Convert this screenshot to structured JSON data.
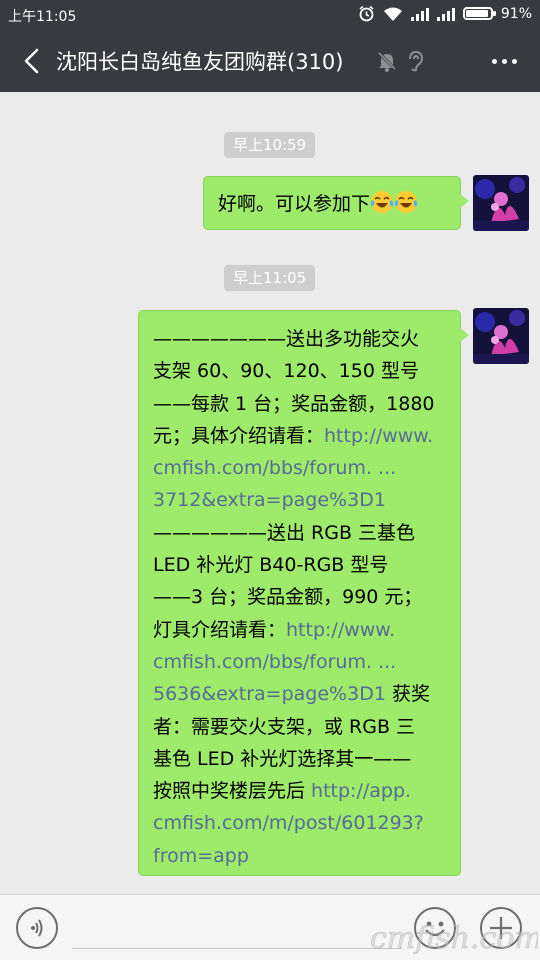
{
  "status_bar": {
    "time": "上午11:05",
    "battery": "91%",
    "icons": [
      "alarm-icon",
      "wifi-icon",
      "signal-icon",
      "signal-icon",
      "battery-icon"
    ]
  },
  "header": {
    "back_icon": "back-arrow-icon",
    "title": "沈阳长白岛纯鱼友团购群(310)",
    "mute_icon": "mute-bell-icon",
    "earpiece_icon": "earpiece-icon",
    "more_icon": "more-icon"
  },
  "messages": [
    {
      "timestamp": "早上10:59",
      "sender": "self",
      "text": "好啊。可以参加下",
      "emojis": [
        "laughing-crying-emoji",
        "laughing-crying-emoji"
      ]
    },
    {
      "timestamp": "早上11:05",
      "sender": "self",
      "lines": [
        {
          "text": "———————送出多功能交火"
        },
        {
          "text": "支架 60、90、120、150 型号"
        },
        {
          "text": "——每款 1 台；奖品金额，1880"
        },
        {
          "text": "元；具体介绍请看：",
          "link": "http://www."
        },
        {
          "link": "cmfish.com/bbs/forum. ..."
        },
        {
          "link": "3712&extra=page%3D1"
        },
        {
          "text": "——————送出 RGB 三基色"
        },
        {
          "text": "LED 补光灯 B40-RGB 型号"
        },
        {
          "text": "——3 台；奖品金额，990 元；"
        },
        {
          "text": "灯具介绍请看：",
          "link": "http://www."
        },
        {
          "link": "cmfish.com/bbs/forum. ..."
        },
        {
          "link": "5636&extra=page%3D1",
          "text_after": " 获奖"
        },
        {
          "text": "者：需要交火支架，或 RGB 三"
        },
        {
          "text": "基色 LED 补光灯选择其一——"
        },
        {
          "text": "按照中奖楼层先后 ",
          "link": "http://app."
        },
        {
          "link": "cmfish.com/m/post/601293?"
        },
        {
          "link": "from=app"
        }
      ]
    }
  ],
  "input_bar": {
    "voice_icon": "voice-icon",
    "input_value": "",
    "emoji_icon": "emoji-icon",
    "plus_icon": "plus-icon"
  },
  "watermark": "cmfish.com",
  "colors": {
    "header_bg": "#393a3f",
    "chat_bg": "#ebebeb",
    "bubble": "#9eea6a",
    "link": "#576b95",
    "timestamp_bg": "#cecece"
  }
}
